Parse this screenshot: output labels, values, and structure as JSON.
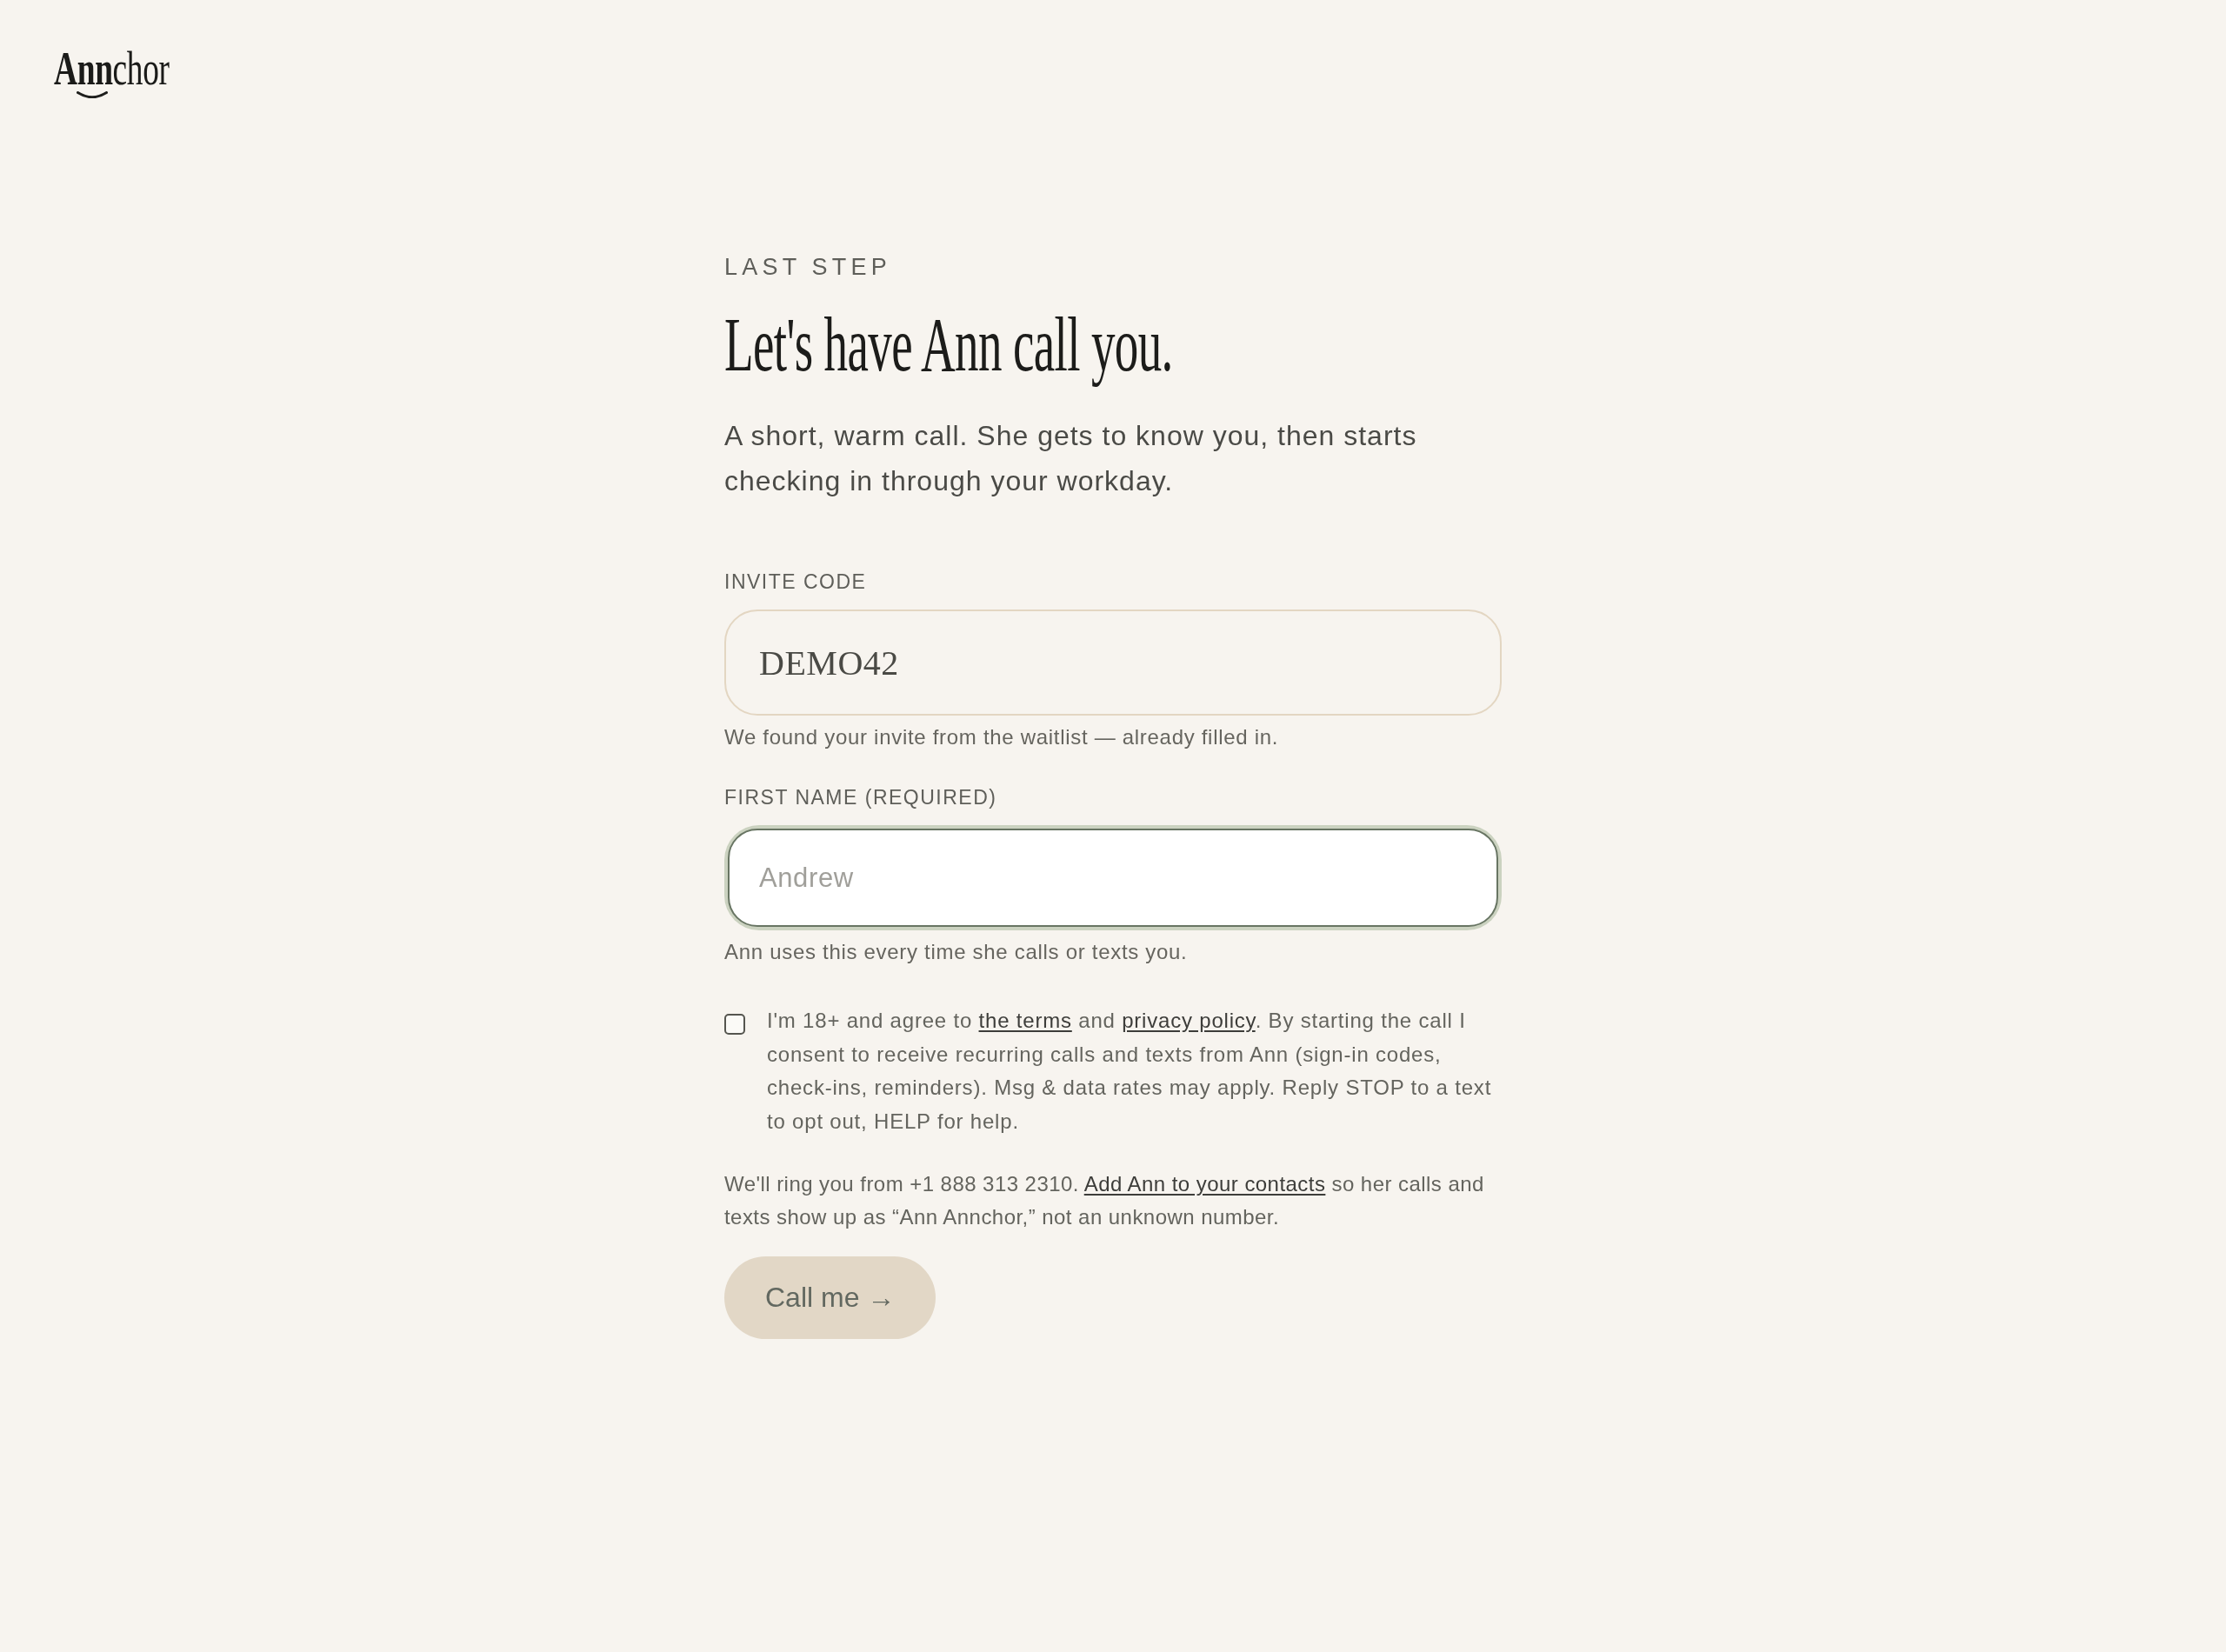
{
  "logo": {
    "wordmark": "**Ann**chor"
  },
  "eyebrow": "LAST STEP",
  "heading": "Let's have Ann call you.",
  "subtitle": "A short, warm call. She gets to know you, then starts checking in through your workday.",
  "fields": [
    {
      "kind": "code",
      "label": "INVITE CODE",
      "value": "DEMO42",
      "focused": false,
      "hint": "We found your invite from the waitlist — already filled in."
    },
    {
      "kind": "text",
      "label": "FIRST NAME (REQUIRED)",
      "placeholder": "Andrew",
      "focused": true,
      "hint": "Ann uses this every time she calls or texts you."
    }
  ],
  "consent": {
    "checked": false,
    "parts": [
      {
        "kind": "text",
        "text": "I'm 18+ and agree to "
      },
      {
        "kind": "link",
        "text": "the terms"
      },
      {
        "kind": "text",
        "text": " and "
      },
      {
        "kind": "link",
        "text": "privacy policy"
      },
      {
        "kind": "text",
        "text": ". By starting the call I consent to receive recurring calls and texts from Ann (sign-in codes, check-ins, reminders). Msg & data rates may apply. Reply STOP to a text to opt out, HELP for help."
      }
    ]
  },
  "note": {
    "parts": [
      {
        "kind": "text",
        "text": "We'll ring you from +1 888 313 2310. "
      },
      {
        "kind": "link",
        "text": "Add Ann to your contacts"
      },
      {
        "kind": "text",
        "text": " so her calls and texts show up as “Ann Annchor,” not an unknown number."
      }
    ]
  },
  "button": {
    "label": "Call me →"
  }
}
